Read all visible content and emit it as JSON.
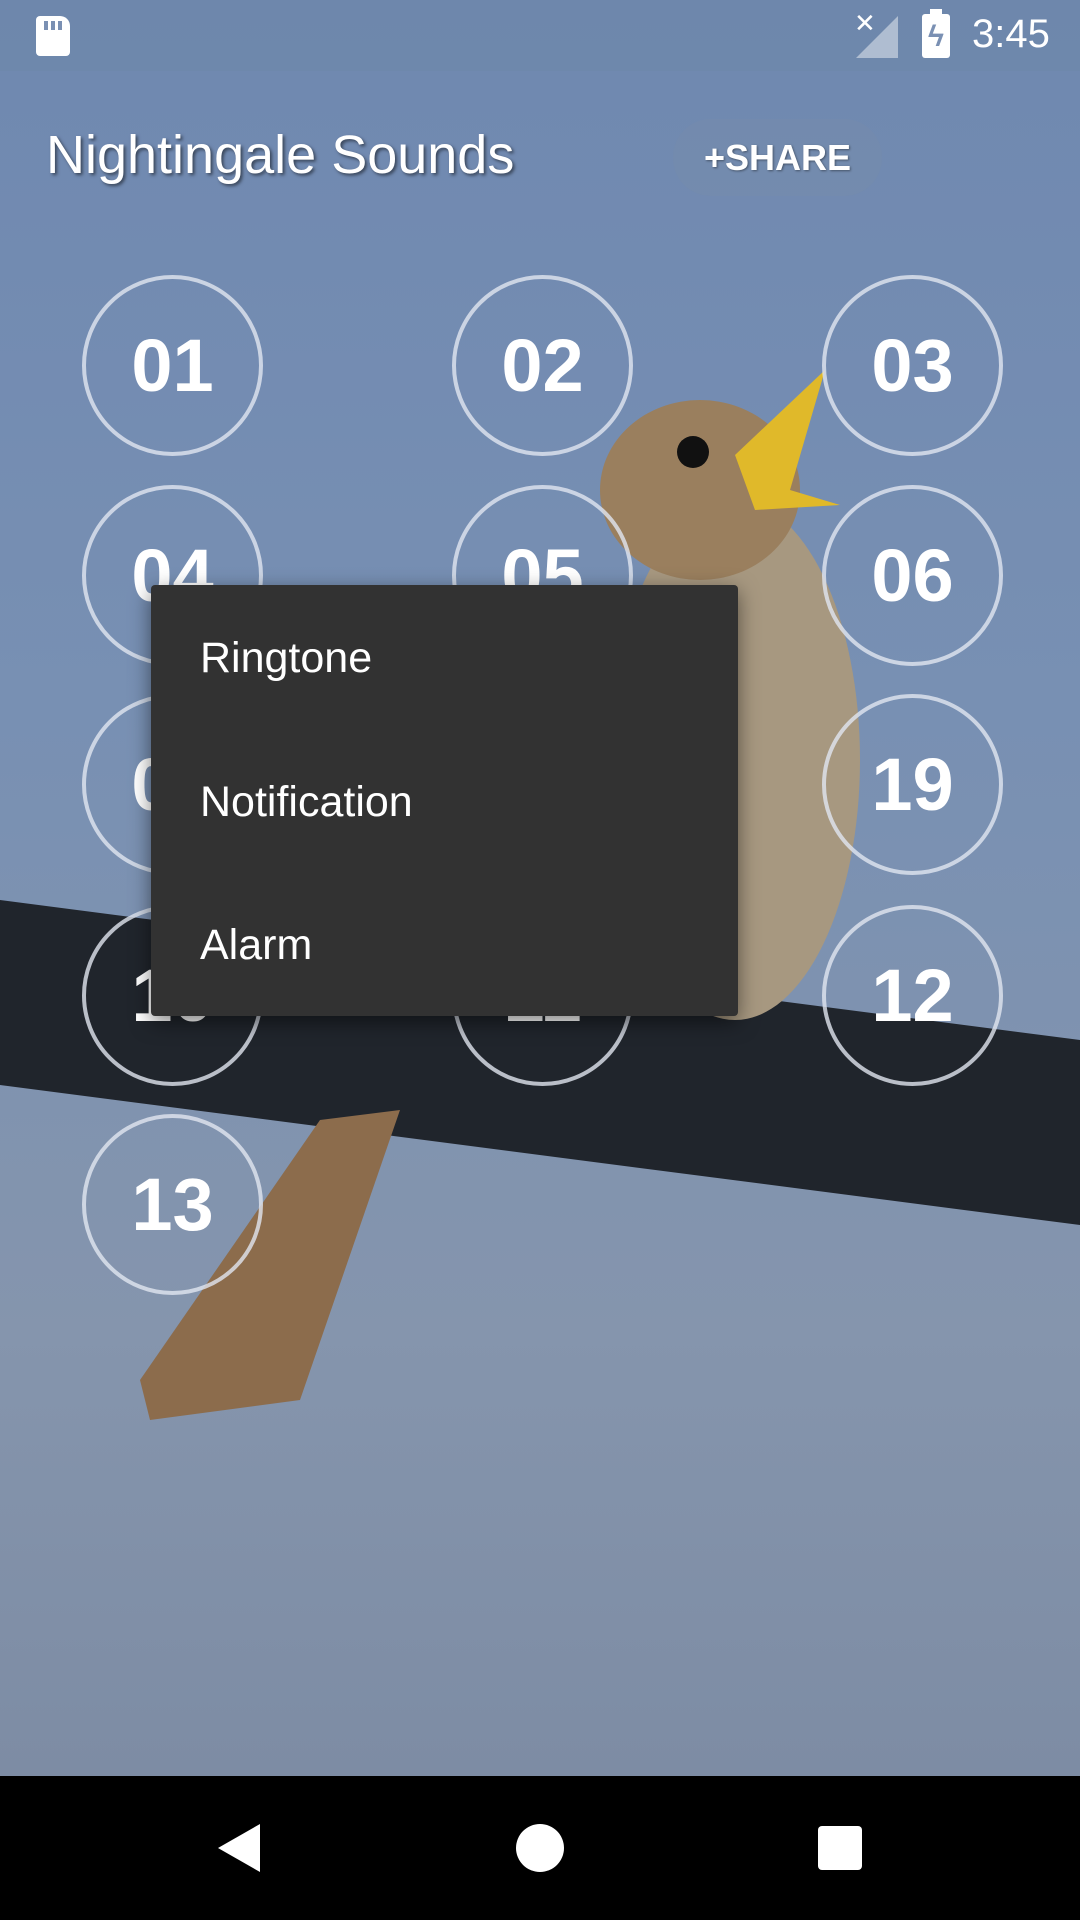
{
  "status_bar": {
    "time": "3:45",
    "icons": [
      "sd-card-icon",
      "no-signal-icon",
      "battery-charging-icon"
    ]
  },
  "header": {
    "title": "Nightingale Sounds",
    "share_label": "+SHARE"
  },
  "sounds": [
    {
      "label": "01"
    },
    {
      "label": "02"
    },
    {
      "label": "03"
    },
    {
      "label": "04"
    },
    {
      "label": "05"
    },
    {
      "label": "06"
    },
    {
      "label": "07"
    },
    {
      "label": "19"
    },
    {
      "label": "10"
    },
    {
      "label": "11"
    },
    {
      "label": "12"
    },
    {
      "label": "13"
    }
  ],
  "context_menu": {
    "items": [
      {
        "label": "Ringtone"
      },
      {
        "label": "Notification"
      },
      {
        "label": "Alarm"
      }
    ]
  },
  "nav_bar": {
    "buttons": [
      "back-icon",
      "home-icon",
      "recents-icon"
    ]
  },
  "colors": {
    "menu_bg": "#323232",
    "sky": "#7890b3"
  }
}
